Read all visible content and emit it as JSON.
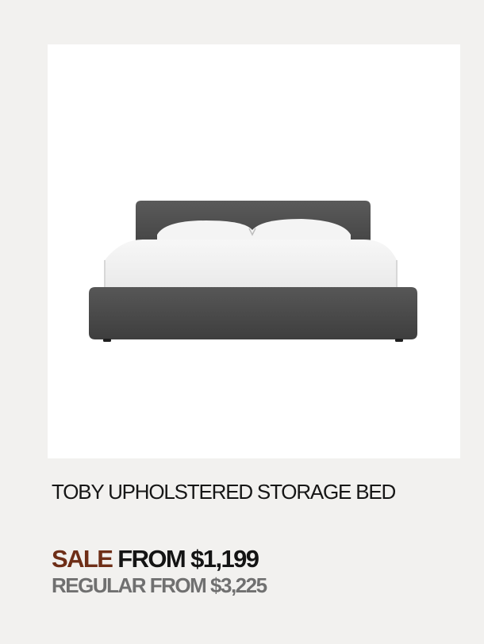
{
  "product": {
    "image_alt": "Upholstered storage bed with charcoal fabric frame, white bedding and pillows",
    "title": "TOBY UPHOLSTERED STORAGE BED",
    "sale_label": "SALE",
    "sale_price": "FROM $1,199",
    "regular_price": "REGULAR FROM $3,225"
  },
  "colors": {
    "page_background": "#f2f1ef",
    "sale_accent": "#6e2e17",
    "regular_text": "#707070",
    "fabric": "#4a4a4a"
  }
}
